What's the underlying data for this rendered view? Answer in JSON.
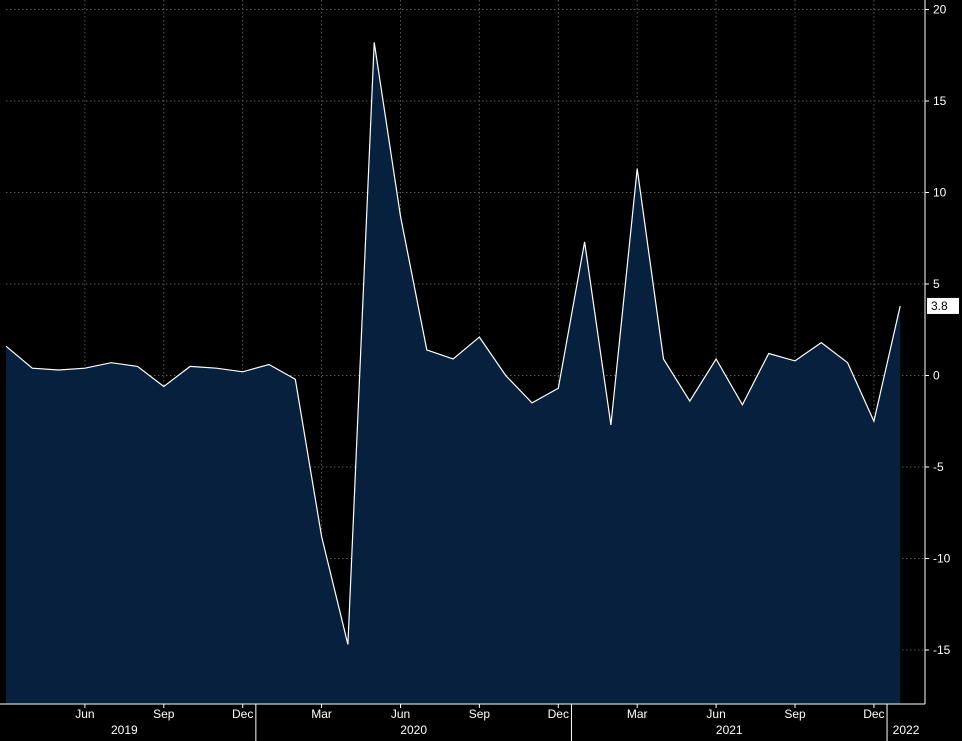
{
  "chart_data": {
    "type": "area",
    "title": "",
    "xlabel": "",
    "ylabel": "",
    "x": [
      "2019-03",
      "2019-04",
      "2019-05",
      "2019-06",
      "2019-07",
      "2019-08",
      "2019-09",
      "2019-10",
      "2019-11",
      "2019-12",
      "2020-01",
      "2020-02",
      "2020-03",
      "2020-04",
      "2020-05",
      "2020-06",
      "2020-07",
      "2020-08",
      "2020-09",
      "2020-10",
      "2020-11",
      "2020-12",
      "2021-01",
      "2021-02",
      "2021-03",
      "2021-04",
      "2021-05",
      "2021-06",
      "2021-07",
      "2021-08",
      "2021-09",
      "2021-10",
      "2021-11",
      "2021-12",
      "2022-01"
    ],
    "series": [
      {
        "values": [
          1.6,
          0.4,
          0.3,
          0.4,
          0.7,
          0.5,
          -0.6,
          0.5,
          0.4,
          0.2,
          0.6,
          -0.2,
          -8.8,
          -14.7,
          18.2,
          8.7,
          1.4,
          0.9,
          2.1,
          0.0,
          -1.5,
          -0.7,
          7.3,
          -2.7,
          11.3,
          0.9,
          -1.4,
          0.9,
          -1.6,
          1.2,
          0.8,
          1.8,
          0.7,
          -2.5,
          3.8
        ]
      }
    ],
    "ylim": [
      -17.5,
      20.2
    ],
    "y_ticks": [
      "20",
      "15",
      "10",
      "5",
      "0",
      "-5",
      "-10",
      "-15"
    ],
    "x_ticks": [
      {
        "x": "2019-06",
        "label": "Jun"
      },
      {
        "x": "2019-09",
        "label": "Sep"
      },
      {
        "x": "2019-12",
        "label": "Dec"
      },
      {
        "x": "2020-03",
        "label": "Mar"
      },
      {
        "x": "2020-06",
        "label": "Jun"
      },
      {
        "x": "2020-09",
        "label": "Sep"
      },
      {
        "x": "2020-12",
        "label": "Dec"
      },
      {
        "x": "2021-03",
        "label": "Mar"
      },
      {
        "x": "2021-06",
        "label": "Jun"
      },
      {
        "x": "2021-09",
        "label": "Sep"
      },
      {
        "x": "2021-12",
        "label": "Dec"
      }
    ],
    "years": [
      {
        "label": "2019",
        "from": "2019-03",
        "to": "2019-12"
      },
      {
        "label": "2020",
        "from": "2020-01",
        "to": "2020-12"
      },
      {
        "label": "2021",
        "from": "2021-01",
        "to": "2021-12"
      },
      {
        "label": "2022",
        "from": "2022-01",
        "to": "2022-01"
      }
    ],
    "last_value_label": "3.8",
    "grid": true,
    "colors": {
      "background": "#000000",
      "area_fill": "#06203d",
      "line": "#ffffff",
      "grid": "#5a5a5a",
      "text": "#ffffff"
    }
  }
}
